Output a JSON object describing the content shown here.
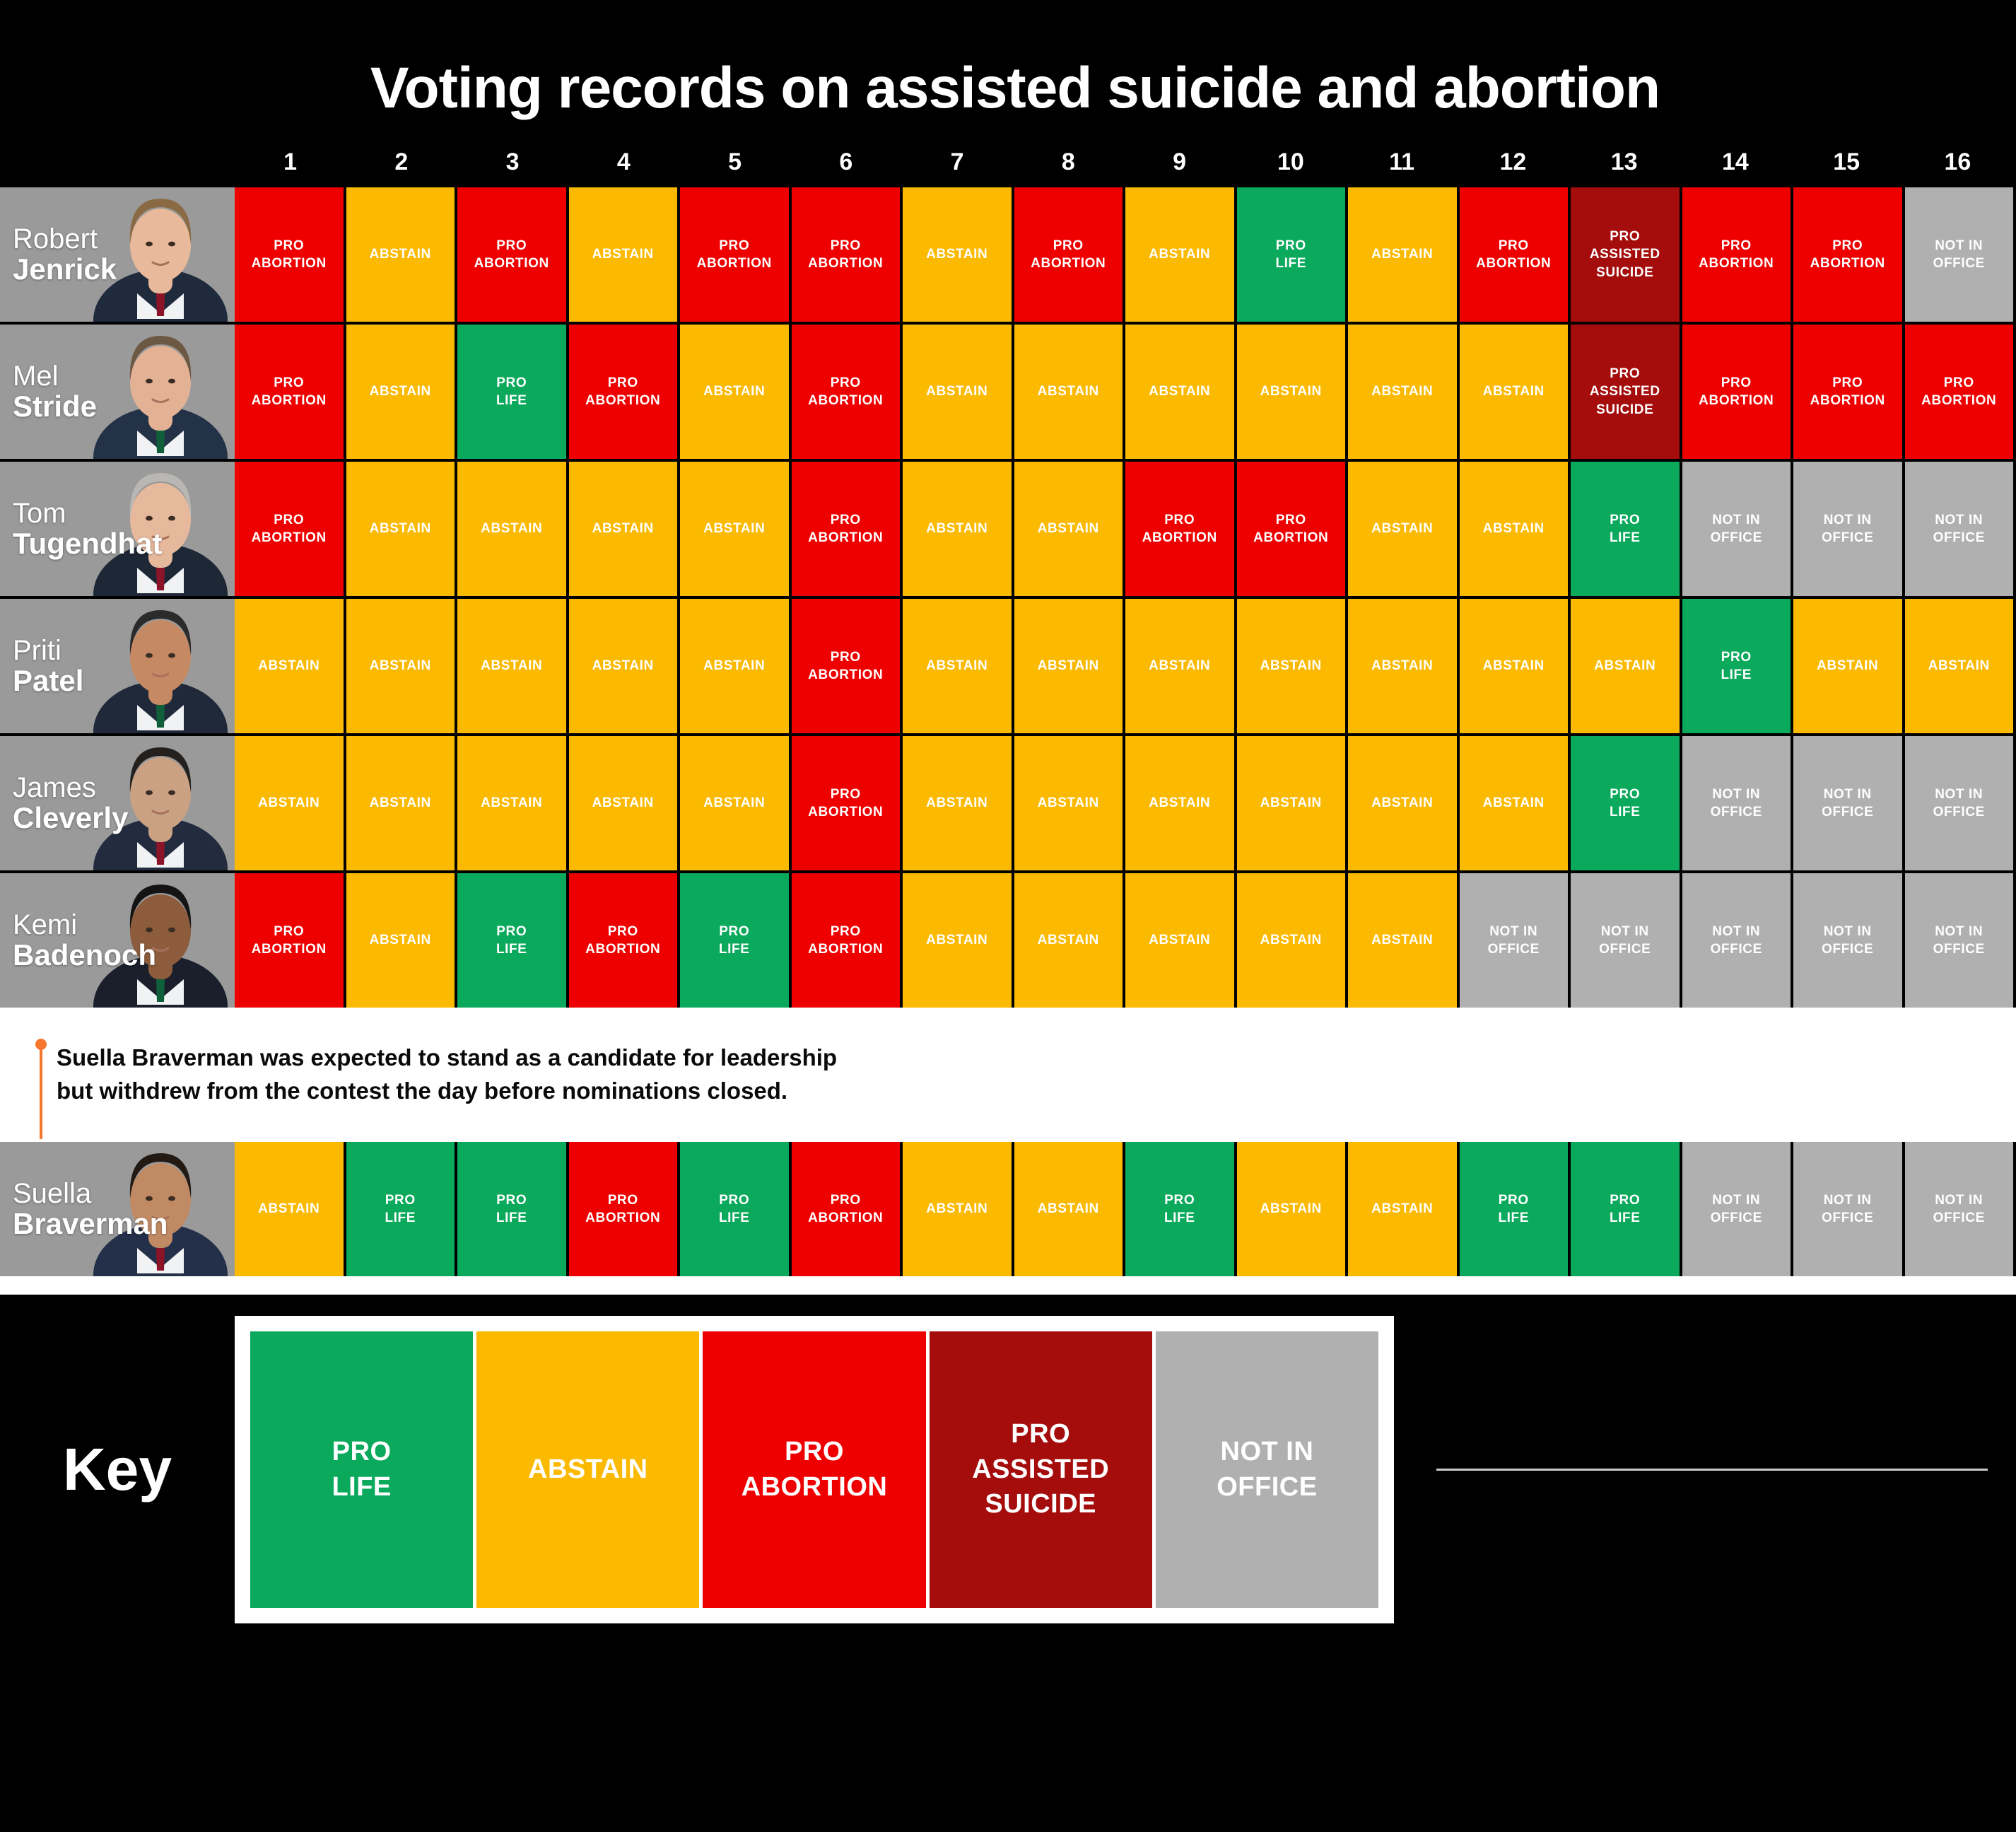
{
  "header": {
    "title": "Voting records on assisted suicide and abortion"
  },
  "columns": [
    "1",
    "2",
    "3",
    "4",
    "5",
    "6",
    "7",
    "8",
    "9",
    "10",
    "11",
    "12",
    "13",
    "14",
    "15",
    "16"
  ],
  "legend_colors": {
    "pro_life": "#0aa95c",
    "abstain": "#fbb900",
    "pro_abortion": "#ee0000",
    "pro_assisted_suicide": "#a50c0c",
    "not_in_office": "#b0b0b0",
    "annotation_accent": "#f5762c",
    "background": "#000000",
    "name_cell": "#9a9a9a"
  },
  "candidates": [
    {
      "first_name": "Robert",
      "last_name": "Jenrick",
      "votes": [
        "PRO ABORTION",
        "ABSTAIN",
        "PRO ABORTION",
        "ABSTAIN",
        "PRO ABORTION",
        "PRO ABORTION",
        "ABSTAIN",
        "PRO ABORTION",
        "ABSTAIN",
        "PRO LIFE",
        "ABSTAIN",
        "PRO ABORTION",
        "PRO ASSISTED SUICIDE",
        "PRO ABORTION",
        "PRO ABORTION",
        "NOT IN OFFICE"
      ]
    },
    {
      "first_name": "Mel",
      "last_name": "Stride",
      "votes": [
        "PRO ABORTION",
        "ABSTAIN",
        "PRO LIFE",
        "PRO ABORTION",
        "ABSTAIN",
        "PRO ABORTION",
        "ABSTAIN",
        "ABSTAIN",
        "ABSTAIN",
        "ABSTAIN",
        "ABSTAIN",
        "ABSTAIN",
        "PRO ASSISTED SUICIDE",
        "PRO ABORTION",
        "PRO ABORTION",
        "PRO ABORTION"
      ]
    },
    {
      "first_name": "Tom",
      "last_name": "Tugendhat",
      "votes": [
        "PRO ABORTION",
        "ABSTAIN",
        "ABSTAIN",
        "ABSTAIN",
        "ABSTAIN",
        "PRO ABORTION",
        "ABSTAIN",
        "ABSTAIN",
        "PRO ABORTION",
        "PRO ABORTION",
        "ABSTAIN",
        "ABSTAIN",
        "PRO LIFE",
        "NOT IN OFFICE",
        "NOT IN OFFICE",
        "NOT IN OFFICE"
      ]
    },
    {
      "first_name": "Priti",
      "last_name": "Patel",
      "votes": [
        "ABSTAIN",
        "ABSTAIN",
        "ABSTAIN",
        "ABSTAIN",
        "ABSTAIN",
        "PRO ABORTION",
        "ABSTAIN",
        "ABSTAIN",
        "ABSTAIN",
        "ABSTAIN",
        "ABSTAIN",
        "ABSTAIN",
        "ABSTAIN",
        "PRO LIFE",
        "ABSTAIN",
        "ABSTAIN"
      ]
    },
    {
      "first_name": "James",
      "last_name": "Cleverly",
      "votes": [
        "ABSTAIN",
        "ABSTAIN",
        "ABSTAIN",
        "ABSTAIN",
        "ABSTAIN",
        "PRO ABORTION",
        "ABSTAIN",
        "ABSTAIN",
        "ABSTAIN",
        "ABSTAIN",
        "ABSTAIN",
        "ABSTAIN",
        "PRO LIFE",
        "NOT IN OFFICE",
        "NOT IN OFFICE",
        "NOT IN OFFICE"
      ]
    },
    {
      "first_name": "Kemi",
      "last_name": "Badenoch",
      "votes": [
        "PRO ABORTION",
        "ABSTAIN",
        "PRO LIFE",
        "PRO ABORTION",
        "PRO LIFE",
        "PRO ABORTION",
        "ABSTAIN",
        "ABSTAIN",
        "ABSTAIN",
        "ABSTAIN",
        "ABSTAIN",
        "NOT IN OFFICE",
        "NOT IN OFFICE",
        "NOT IN OFFICE",
        "NOT IN OFFICE",
        "NOT IN OFFICE"
      ]
    }
  ],
  "annotation": {
    "line1": "Suella Braverman was expected to stand as a candidate for leadership",
    "line2": "but withdrew from the contest the day before nominations closed."
  },
  "withdrawn_candidate": {
    "first_name": "Suella",
    "last_name": "Braverman",
    "votes": [
      "ABSTAIN",
      "PRO LIFE",
      "PRO LIFE",
      "PRO ABORTION",
      "PRO LIFE",
      "PRO ABORTION",
      "ABSTAIN",
      "ABSTAIN",
      "PRO LIFE",
      "ABSTAIN",
      "ABSTAIN",
      "PRO LIFE",
      "PRO LIFE",
      "NOT IN OFFICE",
      "NOT IN OFFICE",
      "NOT IN OFFICE"
    ]
  },
  "key": {
    "label": "Key",
    "items": [
      {
        "label": "PRO LIFE",
        "color": "#0aa95c"
      },
      {
        "label": "ABSTAIN",
        "color": "#fbb900"
      },
      {
        "label": "PRO ABORTION",
        "color": "#ee0000"
      },
      {
        "label": "PRO ASSISTED SUICIDE",
        "color": "#a50c0c"
      },
      {
        "label": "NOT IN OFFICE",
        "color": "#b0b0b0"
      }
    ]
  }
}
